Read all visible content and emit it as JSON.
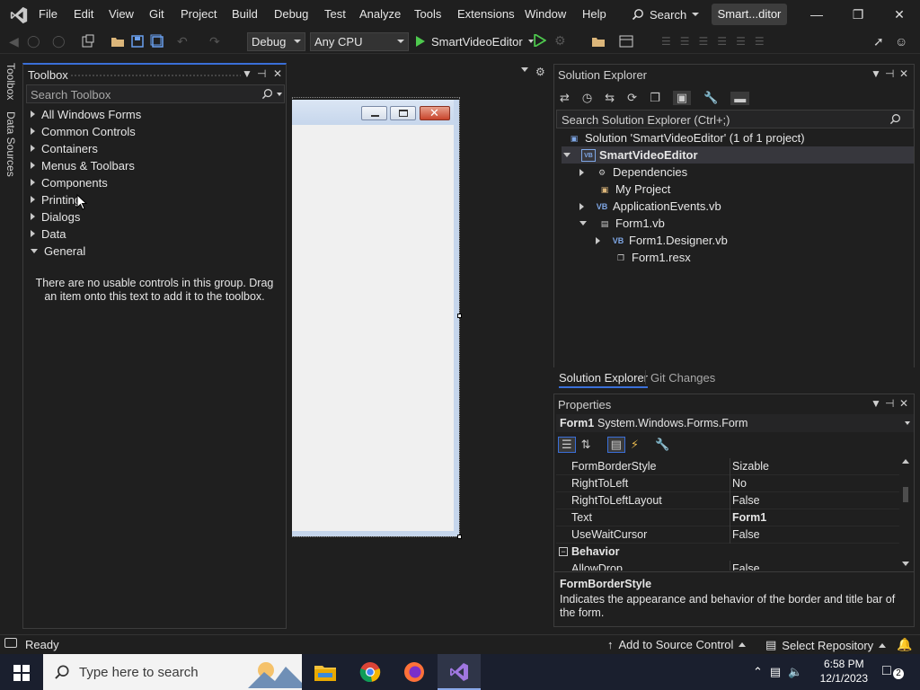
{
  "menubar": {
    "items": [
      "File",
      "Edit",
      "View",
      "Git",
      "Project",
      "Build",
      "Debug",
      "Test",
      "Analyze",
      "Tools",
      "Extensions",
      "Window",
      "Help"
    ],
    "search_label": "Search",
    "solution_name": "Smart...ditor"
  },
  "toolbar": {
    "configuration": "Debug",
    "platform": "Any CPU",
    "start_project": "SmartVideoEditor"
  },
  "side_tabs": {
    "toolbox": "Toolbox",
    "data_sources": "Data Sources"
  },
  "toolbox": {
    "title": "Toolbox",
    "search_placeholder": "Search Toolbox",
    "groups": [
      "All Windows Forms",
      "Common Controls",
      "Containers",
      "Menus & Toolbars",
      "Components",
      "Printing",
      "Dialogs",
      "Data",
      "General"
    ],
    "expanded_group": "General",
    "empty_message": "There are no usable controls in this group. Drag an item onto this text to add it to the toolbox."
  },
  "solution_explorer": {
    "title": "Solution Explorer",
    "search_placeholder": "Search Solution Explorer (Ctrl+;)",
    "tree": {
      "solution": "Solution 'SmartVideoEditor' (1 of 1 project)",
      "project": "SmartVideoEditor",
      "dependencies": "Dependencies",
      "my_project": "My Project",
      "application_events": "ApplicationEvents.vb",
      "form1": "Form1.vb",
      "form1_designer": "Form1.Designer.vb",
      "form1_resx": "Form1.resx"
    },
    "tabs": [
      "Solution Explorer",
      "Git Changes"
    ]
  },
  "properties": {
    "title": "Properties",
    "object_name": "Form1",
    "object_type": "System.Windows.Forms.Form",
    "rows": [
      {
        "name": "FormBorderStyle",
        "value": "Sizable"
      },
      {
        "name": "RightToLeft",
        "value": "No"
      },
      {
        "name": "RightToLeftLayout",
        "value": "False"
      },
      {
        "name": "Text",
        "value": "Form1"
      },
      {
        "name": "UseWaitCursor",
        "value": "False"
      }
    ],
    "category": "Behavior",
    "next_row": {
      "name": "AllowDrop",
      "value": "False"
    },
    "description_title": "FormBorderStyle",
    "description_text": "Indicates the appearance and behavior of the border and title bar of the form."
  },
  "statusbar": {
    "status": "Ready",
    "source_control": "Add to Source Control",
    "repository": "Select Repository",
    "notifications": "2"
  },
  "taskbar": {
    "search_placeholder": "Type here to search",
    "time": "6:58 PM",
    "date": "12/1/2023"
  },
  "colors": {
    "accent": "#3a6fd8",
    "vs_purple": "#a077e0",
    "run_green": "#4ec94e",
    "panel_bg": "#1f1f1f"
  }
}
